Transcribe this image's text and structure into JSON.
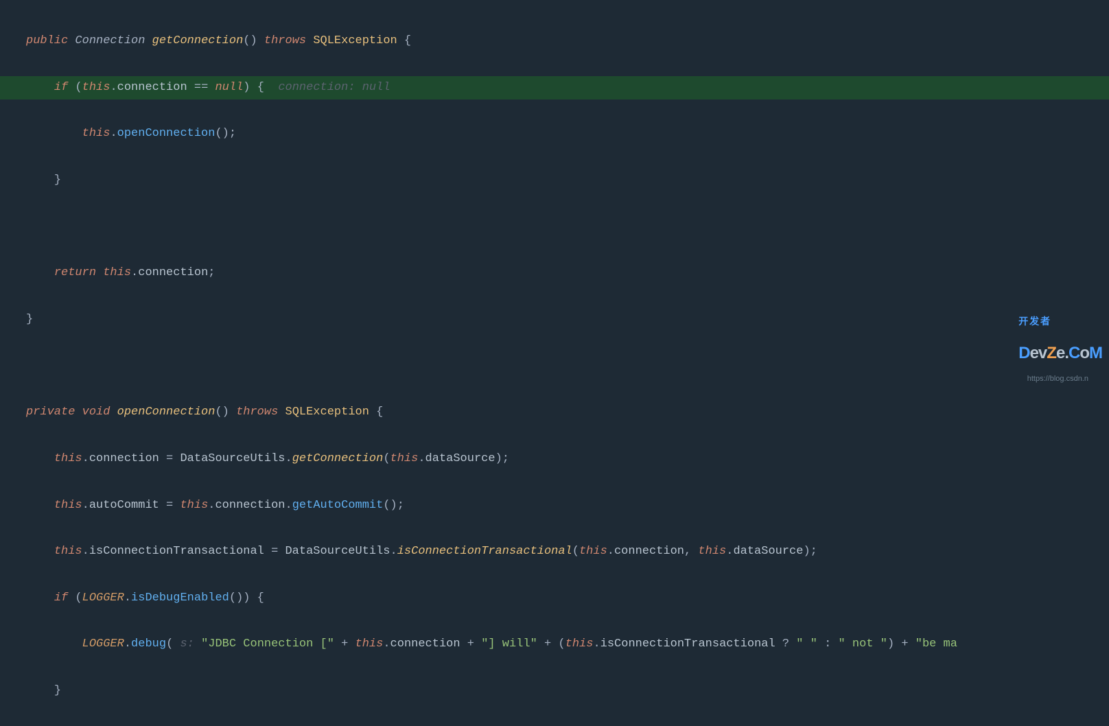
{
  "code": {
    "l1": {
      "kw_public": "public",
      "type": "Connection",
      "method": "getConnection",
      "parens": "()",
      "kw_throws": "throws",
      "exception": "SQLException",
      "brace": " {"
    },
    "l2": {
      "kw_if": "if",
      "lparen": " (",
      "this": "this",
      "dot": ".",
      "field": "connection",
      "op": " == ",
      "null": "null",
      "rparen": ")",
      "brace": " {  ",
      "hint": "connection: null"
    },
    "l3": {
      "this": "this",
      "dot": ".",
      "method": "openConnection",
      "call": "();"
    },
    "l4": {
      "brace": "}"
    },
    "l5": {
      "empty": " "
    },
    "l6": {
      "kw_return": "return",
      "this": " this",
      "dot": ".",
      "field": "connection",
      "semi": ";"
    },
    "l7": {
      "brace": "}"
    },
    "l8": {
      "empty": " "
    },
    "l9": {
      "kw_private": "private",
      "kw_void": "void",
      "method": "openConnection",
      "parens": "()",
      "kw_throws": "throws",
      "exception": "SQLException",
      "brace": " {"
    },
    "l10": {
      "this1": "this",
      "dot1": ".",
      "field1": "connection",
      "eq": " = ",
      "cls": "DataSourceUtils",
      "dot2": ".",
      "method": "getConnection",
      "lparen": "(",
      "this2": "this",
      "dot3": ".",
      "field2": "dataSource",
      "rparen": ");"
    },
    "l11": {
      "this1": "this",
      "dot1": ".",
      "field1": "autoCommit",
      "eq": " = ",
      "this2": "this",
      "dot2": ".",
      "field2": "connection",
      "dot3": ".",
      "method": "getAutoCommit",
      "call": "();"
    },
    "l12": {
      "this1": "this",
      "dot1": ".",
      "field1": "isConnectionTransactional",
      "eq": " = ",
      "cls": "DataSourceUtils",
      "dot2": ".",
      "method": "isConnectionTransactional",
      "lparen": "(",
      "this2": "this",
      "dot3": ".",
      "field2": "connection",
      "comma": ", ",
      "this3": "this",
      "dot4": ".",
      "field3": "dataSource",
      "rparen": ");"
    },
    "l13": {
      "kw_if": "if",
      "lparen": " (",
      "logger": "LOGGER",
      "dot": ".",
      "method": "isDebugEnabled",
      "call": "()) {"
    },
    "l14": {
      "logger": "LOGGER",
      "dot": ".",
      "method": "debug",
      "lparen": "( ",
      "hint": "s: ",
      "str1": "\"JDBC Connection [\"",
      "plus1": " + ",
      "this1": "this",
      "dot1": ".",
      "field1": "connection",
      "plus2": " + ",
      "str2": "\"] will\"",
      "plus3": " + (",
      "this2": "this",
      "dot2": ".",
      "field2": "isConnectionTransactional",
      "tern": " ? ",
      "str3": "\" \"",
      "colon": " : ",
      "str4": "\" not \"",
      "rparen": ") + ",
      "str5": "\"be ma"
    },
    "l15": {
      "brace": "}"
    }
  },
  "watermark": {
    "url": "https://blog.csdn.n",
    "logo_p1": "开 发 者",
    "logo_d": "D",
    "logo_e": "e",
    "logo_v": "v",
    "logo_z": "Z",
    "logo_e2": "e",
    "logo_dot": ".",
    "logo_c": "C",
    "logo_o": "o",
    "logo_m": "M"
  }
}
